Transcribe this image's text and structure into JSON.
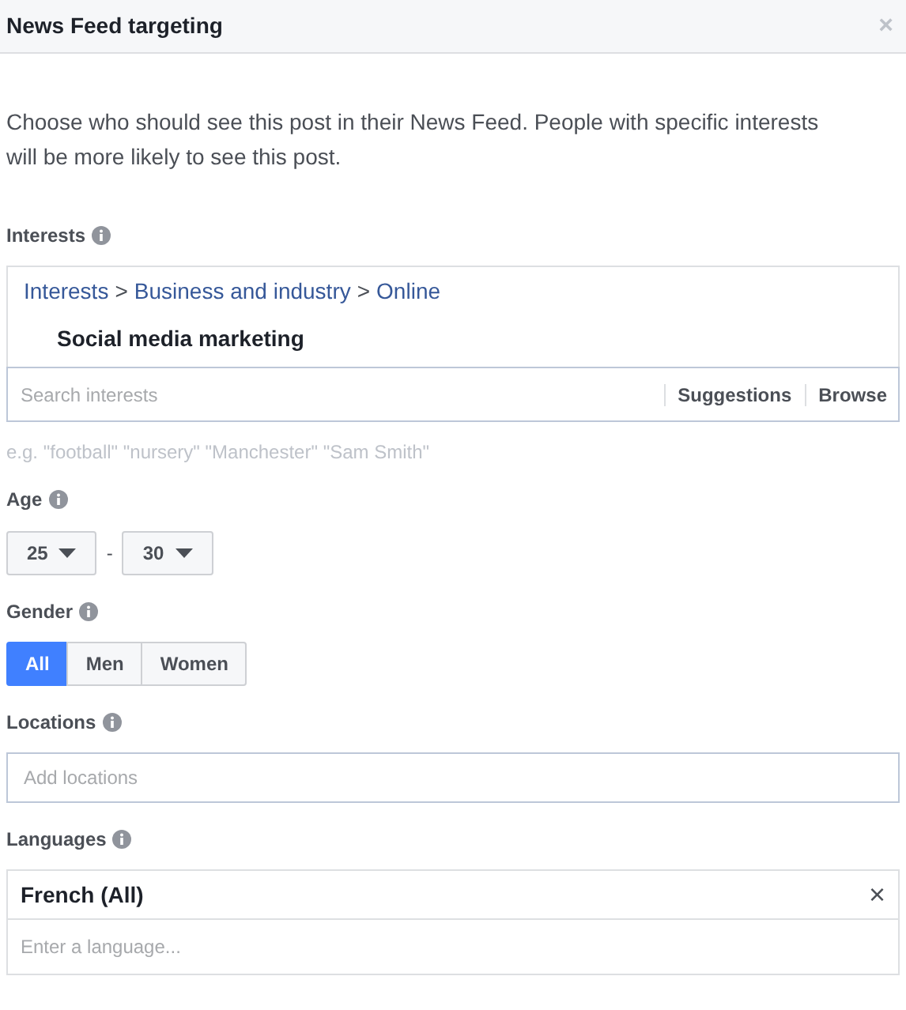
{
  "dialog": {
    "title": "News Feed targeting",
    "close": "×"
  },
  "description": "Choose who should see this post in their News Feed. People with specific interests will be more likely to see this post.",
  "interests": {
    "label": "Interests",
    "breadcrumb": [
      "Interests",
      "Business and industry",
      "Online"
    ],
    "separator": ">",
    "selected_item": "Social media marketing",
    "placeholder": "Search interests",
    "actions": [
      "Suggestions",
      "Browse"
    ],
    "hint": "e.g. \"football\" \"nursery\" \"Manchester\" \"Sam Smith\""
  },
  "age": {
    "label": "Age",
    "min": "25",
    "max": "30",
    "dash": "-"
  },
  "gender": {
    "label": "Gender",
    "options": [
      {
        "label": "All",
        "selected": true
      },
      {
        "label": "Men",
        "selected": false
      },
      {
        "label": "Women",
        "selected": false
      }
    ]
  },
  "locations": {
    "label": "Locations",
    "placeholder": "Add locations"
  },
  "languages": {
    "label": "Languages",
    "tokens": [
      {
        "label": "French (All)",
        "remove": "×"
      }
    ],
    "placeholder": "Enter a language..."
  }
}
